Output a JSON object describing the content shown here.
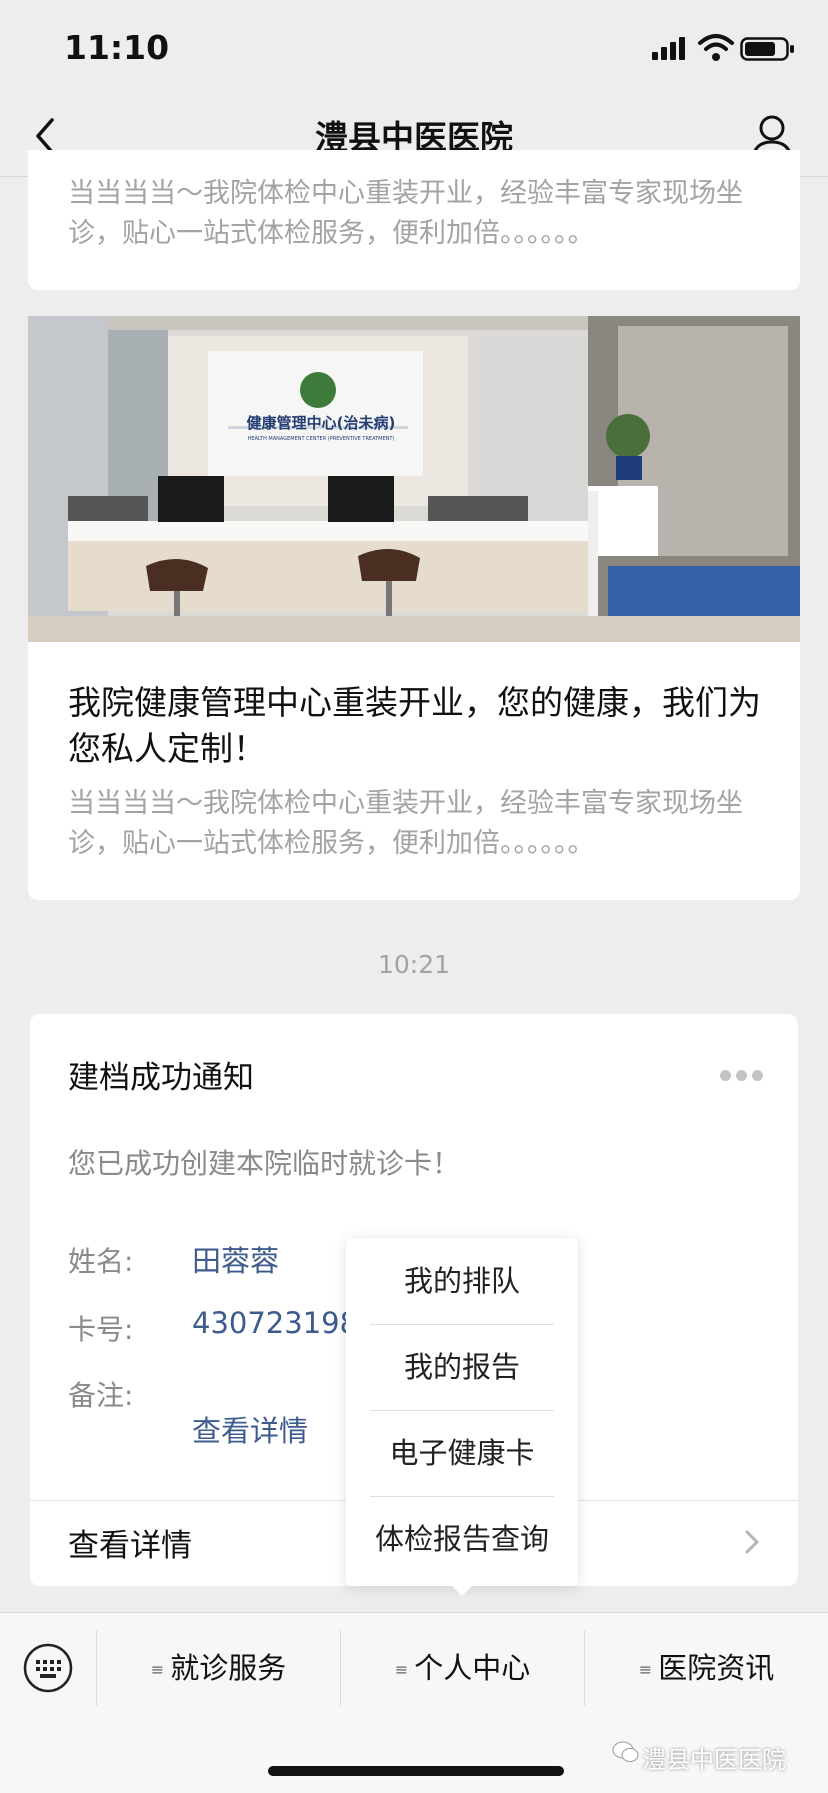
{
  "status_bar": {
    "time": "11:10"
  },
  "nav": {
    "title": "澧县中医医院"
  },
  "top_card": {
    "excerpt": "当当当当～我院体检中心重装开业，经验丰富专家现场坐诊，贴心一站式体检服务，便利加倍。。。。。。"
  },
  "article": {
    "photo_sign_text": "健康管理中心(治未病)",
    "photo_sign_subtext": "HEALTH MANAGEMENT CENTER (PREVENTIVE TREATMENT)",
    "title": "我院健康管理中心重装开业，您的健康，我们为您私人定制！",
    "excerpt": "当当当当～我院体检中心重装开业，经验丰富专家现场坐诊，贴心一站式体检服务，便利加倍。。。。。。"
  },
  "timestamp": "10:21",
  "notice": {
    "title": "建档成功通知",
    "text": "您已成功创建本院临时就诊卡！",
    "name_label": "姓名:",
    "name_value": "田蓉蓉",
    "card_label": "卡号:",
    "card_value": "430723198",
    "remark_label": "备注:",
    "remark_value": "查看详情",
    "details_label": "查看详情"
  },
  "popup_menu": {
    "items": [
      "我的排队",
      "我的报告",
      "电子健康卡",
      "体检报告查询"
    ]
  },
  "bottom_menu": {
    "items": [
      "就诊服务",
      "个人中心",
      "医院资讯"
    ]
  },
  "watermark": "澧县中医医院",
  "icons": [
    "signal-icon",
    "wifi-icon",
    "battery-icon",
    "back-icon",
    "user-icon",
    "more-icon",
    "chevron-right-icon",
    "keyboard-icon",
    "menu-glyph-icon",
    "wechat-icon"
  ]
}
